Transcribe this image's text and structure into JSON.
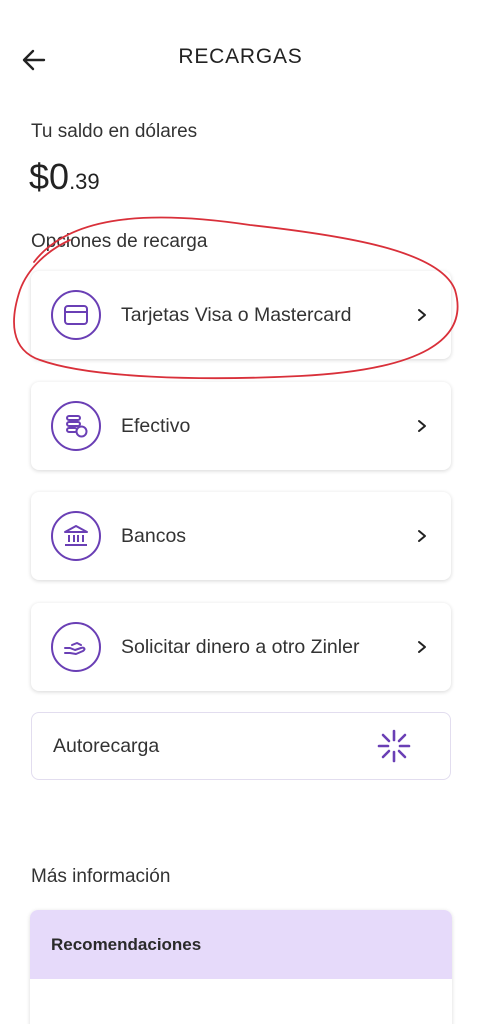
{
  "header": {
    "title": "RECARGAS",
    "back_icon": "arrow-left-icon"
  },
  "balance": {
    "label": "Tu saldo en dólares",
    "currency": "$",
    "whole": "0",
    "cents": ".39"
  },
  "recharge_options": {
    "section_label": "Opciones de recarga",
    "items": [
      {
        "label": "Tarjetas Visa o Mastercard",
        "icon": "credit-card-icon"
      },
      {
        "label": "Efectivo",
        "icon": "cash-coins-icon"
      },
      {
        "label": "Bancos",
        "icon": "bank-icon"
      },
      {
        "label": "Solicitar dinero a otro Zinler",
        "icon": "hand-receive-icon"
      }
    ]
  },
  "autorecharge": {
    "label": "Autorecarga",
    "icon": "autorecharge-icon"
  },
  "more_info": {
    "label": "Más información",
    "recommendations_title": "Recomendaciones"
  },
  "colors": {
    "accent": "#6a3fb5",
    "recommendations_bg": "#e6dafa",
    "annotation": "#d9303a"
  }
}
